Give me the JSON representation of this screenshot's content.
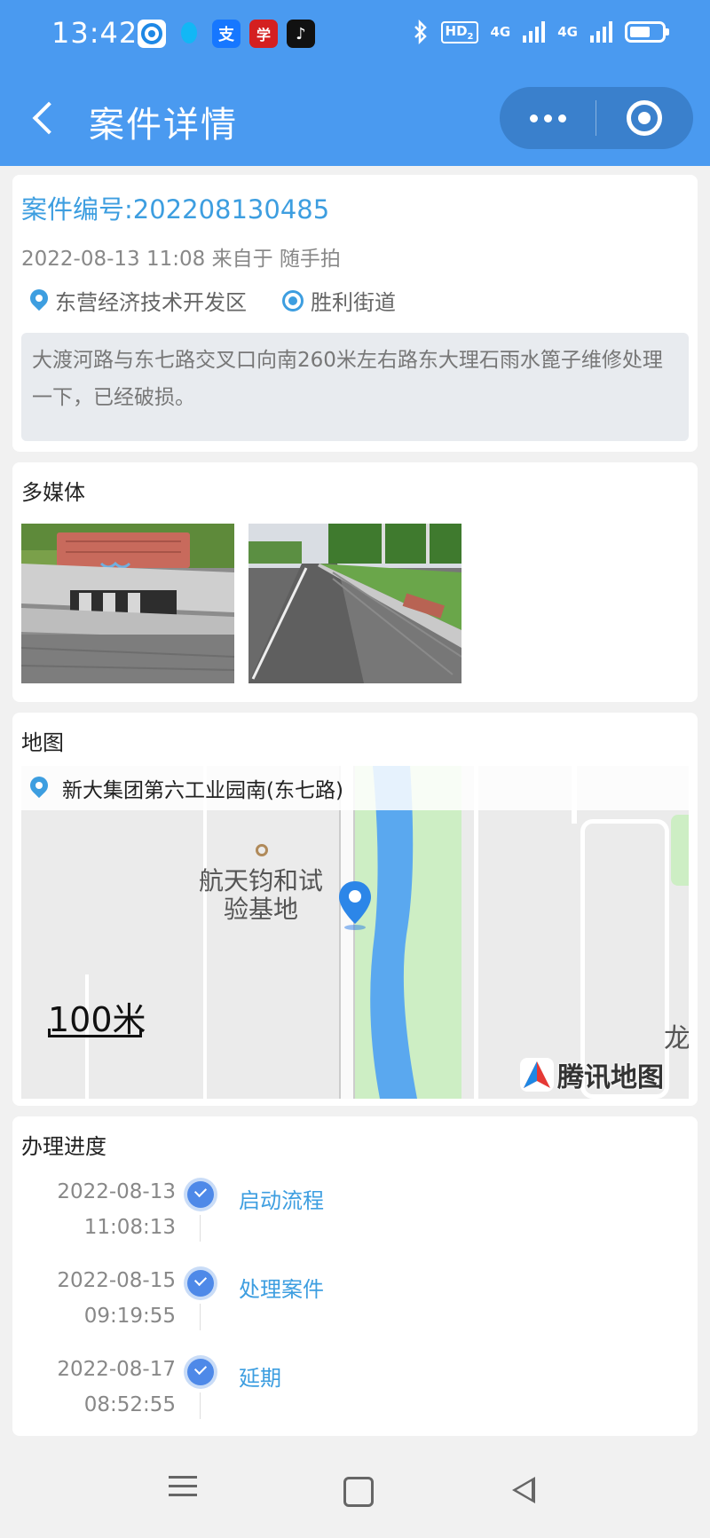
{
  "status_bar": {
    "time": "13:42",
    "apps": [
      {
        "name": "circle-app-icon",
        "color": "#1e88e5",
        "glyph": "◉"
      },
      {
        "name": "qq-icon",
        "color": "#12b7f5",
        "glyph": ""
      },
      {
        "name": "alipay-icon",
        "color": "#1677ff",
        "glyph": "支"
      },
      {
        "name": "xuexi-icon",
        "color": "#d42020",
        "glyph": "学"
      },
      {
        "name": "tiktok-icon",
        "color": "#111111",
        "glyph": "♪"
      }
    ],
    "network": "HD",
    "network_sub": "2",
    "sig1_label": "4G",
    "sig2_label": "4G"
  },
  "nav": {
    "title": "案件详情"
  },
  "case": {
    "number": "案件编号:202208130485",
    "meta": "2022-08-13 11:08 来自于 随手拍",
    "district": "东营经济技术开发区",
    "street": "胜利街道",
    "description": "大渡河路与东七路交叉口向南260米左右路东大理石雨水篦子维修处理一下，已经破损。"
  },
  "media": {
    "title": "多媒体"
  },
  "map": {
    "title": "地图",
    "address": "新大集团第六工业园南(东七路)",
    "poi_label": "航天钧和试验基地",
    "scale": "100米",
    "edge_label": "龙",
    "provider": "腾讯地图"
  },
  "progress": {
    "title": "办理进度",
    "steps": [
      {
        "date": "2022-08-13",
        "time": "11:08:13",
        "label": "启动流程"
      },
      {
        "date": "2022-08-15",
        "time": "09:19:55",
        "label": "处理案件"
      },
      {
        "date": "2022-08-17",
        "time": "08:52:55",
        "label": "延期"
      }
    ]
  },
  "colors": {
    "primary": "#4a9af0",
    "link": "#3d9ee0",
    "check": "#4e89e8"
  }
}
